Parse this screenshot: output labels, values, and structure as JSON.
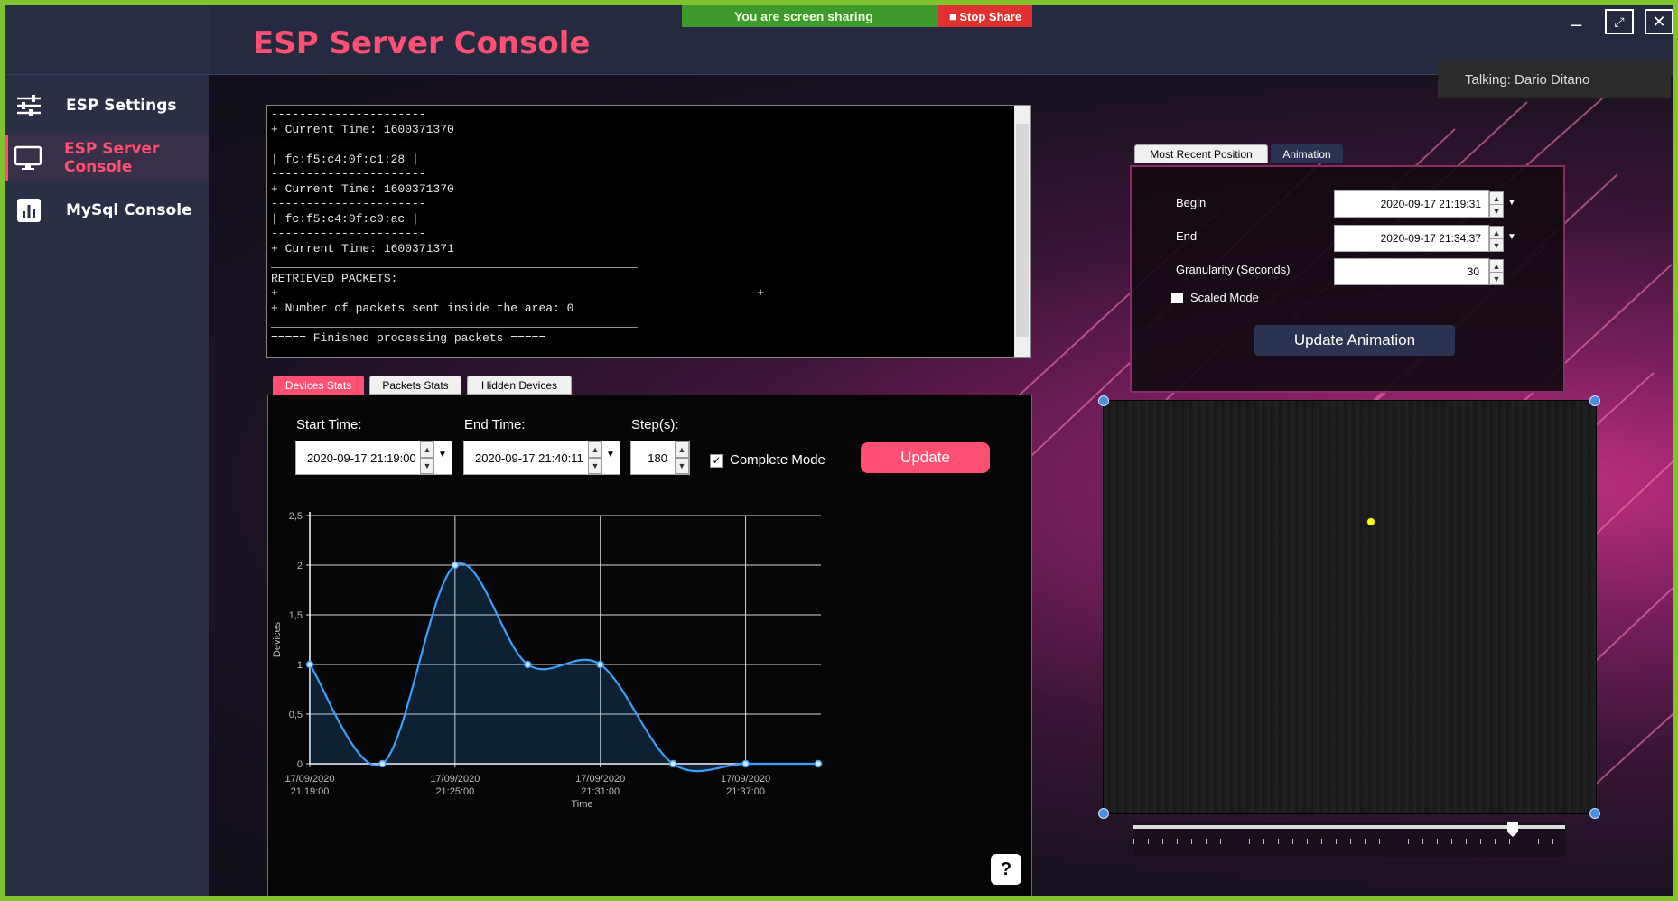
{
  "app": {
    "title": "ESP Server Console"
  },
  "sidebar": {
    "items": [
      {
        "label": "ESP Settings",
        "icon": "sliders-icon",
        "active": false
      },
      {
        "label": "ESP Server Console",
        "icon": "monitor-icon",
        "active": true
      },
      {
        "label": "MySql Console",
        "icon": "bar-chart-icon",
        "active": false
      }
    ]
  },
  "sharing": {
    "text": "You are screen sharing",
    "stop_label": "Stop Share"
  },
  "talking": "Talking: Dario Ditano",
  "console": {
    "lines": [
      "----------------------",
      "+ Current Time: 1600371370",
      "----------------------",
      "| fc:f5:c4:0f:c1:28 |",
      "----------------------",
      "+ Current Time: 1600371370",
      "----------------------",
      "| fc:f5:c4:0f:c0:ac |",
      "----------------------",
      "+ Current Time: 1600371371",
      "____________________________________________________",
      "RETRIEVED PACKETS:",
      "+--------------------------------------------------------------------+",
      "+ Number of packets sent inside the area: 0",
      "____________________________________________________",
      "===== Finished processing packets ====="
    ]
  },
  "stats_tabs": [
    {
      "label": "Devices Stats",
      "active": true
    },
    {
      "label": "Packets Stats",
      "active": false
    },
    {
      "label": "Hidden Devices",
      "active": false
    }
  ],
  "stats_form": {
    "start_label": "Start Time:",
    "start_value": "2020-09-17 21:19:00",
    "end_label": "End Time:",
    "end_value": "2020-09-17 21:40:11",
    "step_label": "Step(s):",
    "step_value": "180",
    "complete_mode_label": "Complete Mode",
    "complete_mode_checked": true,
    "update_label": "Update",
    "help_label": "?"
  },
  "chart_data": {
    "type": "area",
    "xlabel": "Time",
    "ylabel": "Devices",
    "ylim": [
      0,
      2.5
    ],
    "y_ticks": [
      "0",
      "0,5",
      "1",
      "1,5",
      "2",
      "2,5"
    ],
    "x_ticks": [
      {
        "date": "17/09/2020",
        "time": "21:19:00"
      },
      {
        "date": "17/09/2020",
        "time": "21:25:00"
      },
      {
        "date": "17/09/2020",
        "time": "21:31:00"
      },
      {
        "date": "17/09/2020",
        "time": "21:37:00"
      }
    ],
    "x": [
      "21:19:00",
      "21:22:00",
      "21:25:00",
      "21:28:00",
      "21:31:00",
      "21:34:00",
      "21:37:00",
      "21:40:00"
    ],
    "values": [
      1,
      0,
      2,
      1,
      1,
      0,
      0,
      0
    ],
    "grid": true,
    "color": "#3aa0ff"
  },
  "anim_tabs": [
    {
      "label": "Most Recent Position",
      "active": true
    },
    {
      "label": "Animation",
      "active": false
    }
  ],
  "anim_form": {
    "begin_label": "Begin",
    "begin_value": "2020-09-17 21:19:31",
    "end_label": "End",
    "end_value": "2020-09-17 21:34:37",
    "granularity_label": "Granularity (Seconds)",
    "granularity_value": "30",
    "scaled_label": "Scaled Mode",
    "scaled_checked": false,
    "update_label": "Update Animation"
  },
  "colors": {
    "accent": "#ff4f72",
    "frame": "#7fc32e",
    "chart_line": "#3aa0ff",
    "device_dot": "#ffff00"
  }
}
